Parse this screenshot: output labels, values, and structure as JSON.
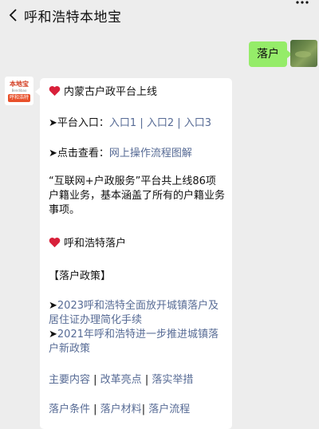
{
  "header": {
    "title": "呼和浩特本地宝"
  },
  "chat": {
    "outgoing_message": "落户"
  },
  "bot": {
    "avatar_logo_top": "本地宝",
    "avatar_logo_mid": "Bendibao",
    "avatar_logo_band": "呼和浩特"
  },
  "card": {
    "section1_title": "内蒙古户政平台上线",
    "entry_prefix": "➤平台入口：",
    "entry_links": [
      "入口1",
      "入口2",
      "入口3"
    ],
    "entry_sep": " | ",
    "view_prefix": "➤点击查看：",
    "view_link": "网上操作流程图解",
    "description": "“互联网+户政服务”平台共上线86项户籍业务，基本涵盖了所有的户籍业务事项。",
    "section2_title": "呼和浩特落户",
    "policy_header": "【落户政策】",
    "policy_arrow": "➤",
    "policy_links": [
      "2023呼和浩特全面放开城镇落户及居住证办理简化手续",
      "2021年呼和浩特进一步推进城镇落户新政策"
    ],
    "nav_row1": [
      "主要内容",
      "改革亮点",
      "落实举措"
    ],
    "nav_row1_sep": " | ",
    "nav_row2": [
      "落户条件",
      "落户材料",
      "落户流程"
    ],
    "nav_row2_seps": [
      " | ",
      "| "
    ]
  },
  "colors": {
    "background": "#ededed",
    "outgoing_bubble": "#95ec69",
    "link": "#576b95",
    "heart": "#d8203a",
    "brand_orange": "#e8502a"
  }
}
